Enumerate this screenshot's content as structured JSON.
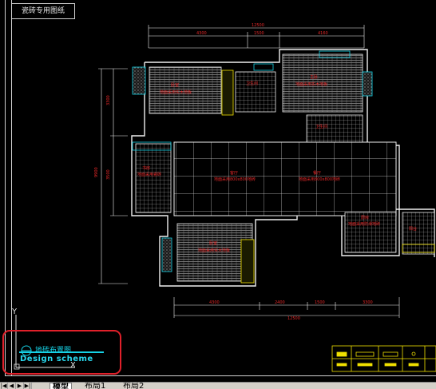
{
  "title_block": "瓷砖专用图纸",
  "legend": {
    "title_cn": "地砖布置图",
    "title_en": "Design scheme"
  },
  "ucs": {
    "y_label": "Y",
    "x_label": "X"
  },
  "tabs": {
    "nav_first": "|◀",
    "nav_prev": "◀",
    "nav_next": "▶",
    "nav_last": "▶|",
    "model": "模型",
    "layout1": "布局1",
    "layout2": "布局2"
  },
  "colors": {
    "background": "#000000",
    "accent_cyan": "#16d2e6",
    "highlight_red": "#e0202a",
    "dimension_red": "#e62828",
    "wall_white": "#f0f0f0",
    "tile_grid": "#c8c8c8",
    "yellow": "#f0e000"
  },
  "icons": [
    "ucs-axis-icon",
    "legend-symbol-icon"
  ]
}
